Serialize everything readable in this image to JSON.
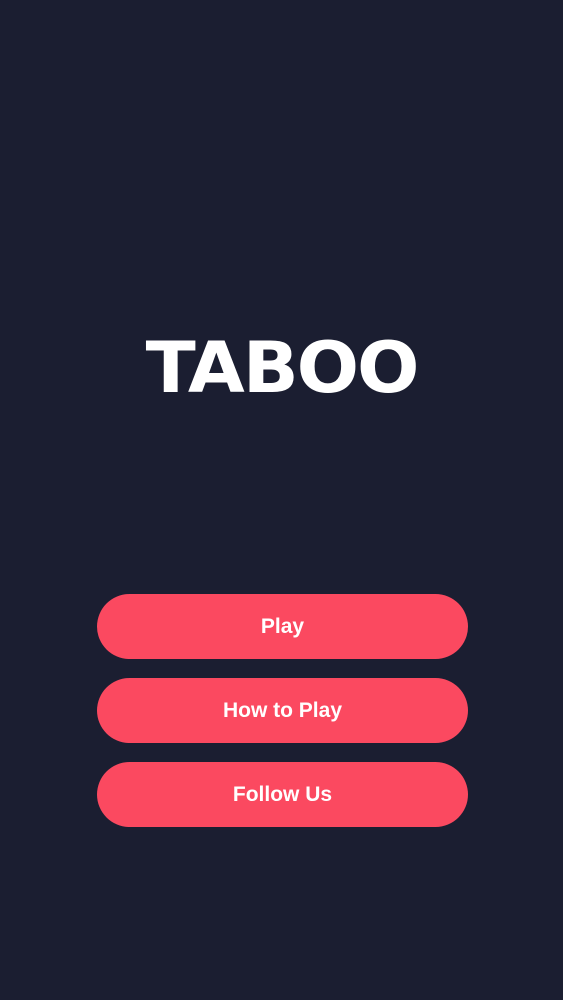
{
  "app": {
    "title": "TABOO"
  },
  "menu": {
    "play_label": "Play",
    "how_to_play_label": "How to Play",
    "follow_us_label": "Follow Us"
  },
  "colors": {
    "background": "#1b1e31",
    "accent": "#fb4960",
    "text": "#ffffff"
  }
}
